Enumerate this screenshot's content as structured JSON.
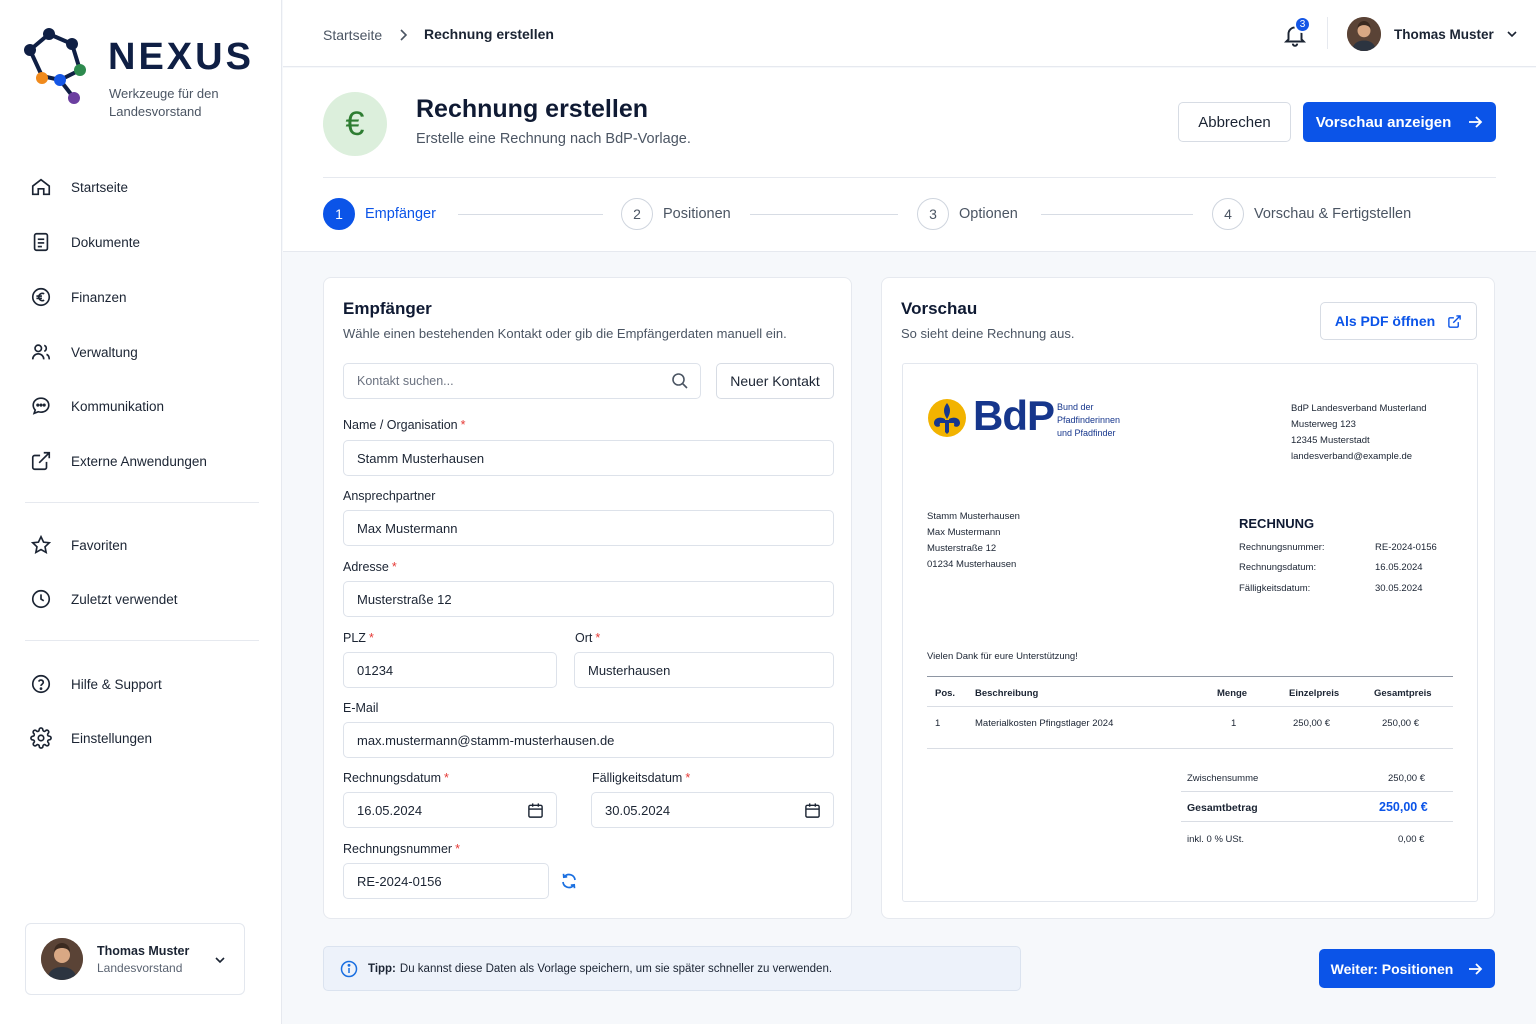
{
  "brand": {
    "name": "NEXUS",
    "subtitle": "Werkzeuge für den Landesvorstand"
  },
  "sidebar": {
    "items": [
      {
        "label": "Startseite",
        "icon": "home-icon"
      },
      {
        "label": "Dokumente",
        "icon": "document-icon"
      },
      {
        "label": "Finanzen",
        "icon": "euro-icon"
      },
      {
        "label": "Verwaltung",
        "icon": "users-icon"
      },
      {
        "label": "Kommunikation",
        "icon": "chat-icon"
      },
      {
        "label": "Externe Anwendungen",
        "icon": "external-link-icon"
      },
      {
        "label": "Favoriten",
        "icon": "star-icon"
      },
      {
        "label": "Zuletzt verwendet",
        "icon": "clock-icon"
      },
      {
        "label": "Hilfe & Support",
        "icon": "help-icon"
      },
      {
        "label": "Einstellungen",
        "icon": "gear-icon"
      }
    ],
    "user": {
      "name": "Thomas Muster",
      "role": "Landesvorstand"
    }
  },
  "header": {
    "breadcrumb_home": "Startseite",
    "breadcrumb_current": "Rechnung erstellen",
    "notification_count": "3",
    "user_name": "Thomas Muster"
  },
  "page": {
    "icon_glyph": "€",
    "title": "Rechnung erstellen",
    "subtitle": "Erstelle eine Rechnung nach BdP-Vorlage.",
    "cancel_label": "Abbrechen",
    "preview_label": "Vorschau anzeigen",
    "steps": [
      {
        "num": "1",
        "label": "Empfänger"
      },
      {
        "num": "2",
        "label": "Positionen"
      },
      {
        "num": "3",
        "label": "Optionen"
      },
      {
        "num": "4",
        "label": "Vorschau & Fertigstellen"
      }
    ]
  },
  "form": {
    "title": "Empfänger",
    "subtitle": "Wähle einen bestehenden Kontakt oder gib die Empfängerdaten manuell ein.",
    "search_placeholder": "Kontakt suchen...",
    "new_contact_label": "Neuer Kontakt",
    "name_label": "Name / Organisation",
    "name_value": "Stamm Musterhausen",
    "contact_label": "Ansprechpartner",
    "contact_value": "Max Mustermann",
    "address_label": "Adresse",
    "address_value": "Musterstraße 12",
    "zip_label": "PLZ",
    "zip_value": "01234",
    "city_label": "Ort",
    "city_value": "Musterhausen",
    "email_label": "E-Mail",
    "email_value": "max.mustermann@stamm-musterhausen.de",
    "invoice_date_label": "Rechnungsdatum",
    "invoice_date_value": "16.05.2024",
    "due_date_label": "Fälligkeitsdatum",
    "due_date_value": "30.05.2024",
    "invoice_number_label": "Rechnungsnummer",
    "invoice_number_value": "RE-2024-0156",
    "required_mark": "*"
  },
  "preview": {
    "title": "Vorschau",
    "subtitle": "So sieht deine Rechnung aus.",
    "pdf_label": "Als PDF öffnen",
    "invoice": {
      "logo_text": "BdP",
      "logo_sub": [
        "Bund der",
        "Pfadfinderinnen",
        "und Pfadfinder"
      ],
      "sender": [
        "BdP Landesverband Musterland",
        "Musterweg 123",
        "12345 Musterstadt",
        "landesverband@example.de"
      ],
      "recipient": [
        "Stamm Musterhausen",
        "Max Mustermann",
        "Musterstraße 12",
        "01234 Musterhausen"
      ],
      "heading": "RECHNUNG",
      "meta": [
        {
          "k": "Rechnungsnummer:",
          "v": "RE-2024-0156"
        },
        {
          "k": "Rechnungsdatum:",
          "v": "16.05.2024"
        },
        {
          "k": "Fälligkeitsdatum:",
          "v": "30.05.2024"
        }
      ],
      "thanks": "Vielen Dank für eure Unterstützung!",
      "columns": [
        "Pos.",
        "Beschreibung",
        "Menge",
        "Einzelpreis",
        "Gesamtpreis"
      ],
      "rows": [
        [
          "1",
          "Materialkosten Pfingstlager 2024",
          "1",
          "250,00 €",
          "250,00 €"
        ]
      ],
      "subtotal_label": "Zwischensumme",
      "subtotal_value": "250,00 €",
      "total_label": "Gesamtbetrag",
      "total_value": "250,00 €",
      "tax_label": "inkl. 0 % USt.",
      "tax_value": "0,00 €"
    }
  },
  "footer": {
    "tip_bold": "Tipp:",
    "tip_text": "Du kannst diese Daten als Vorlage speichern, um sie später schneller zu verwenden.",
    "next_label": "Weiter: Positionen"
  },
  "colors": {
    "accent": "#0b54e8",
    "required": "#e53935",
    "success_bg": "#dcefdc"
  }
}
